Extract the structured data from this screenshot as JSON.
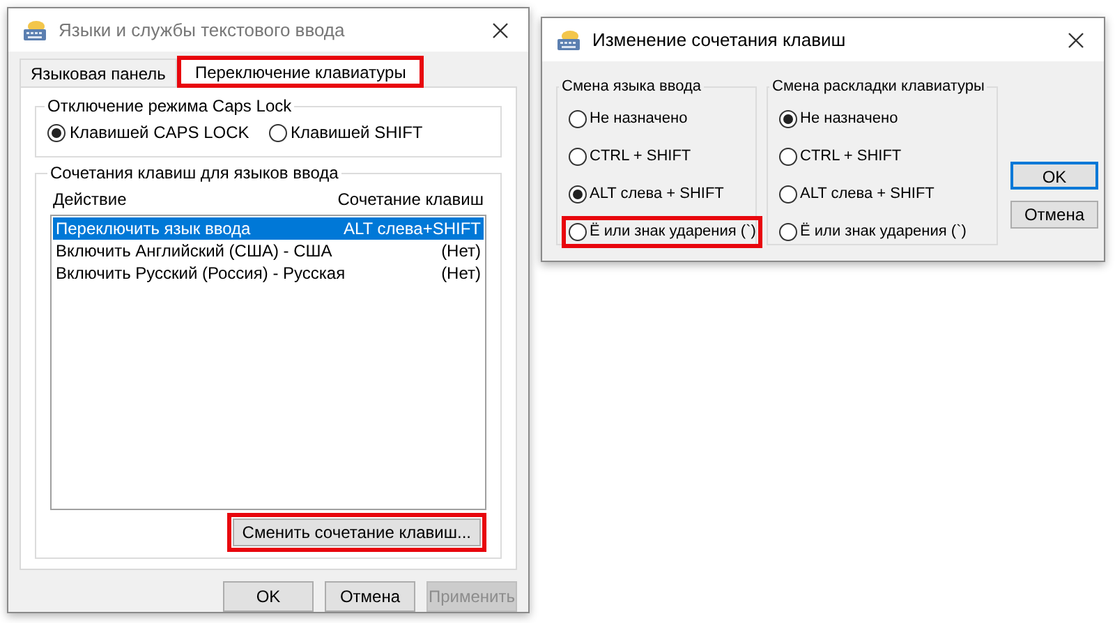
{
  "main_window": {
    "title": "Языки и службы текстового ввода",
    "tabs": [
      {
        "label": "Языковая панель",
        "selected": false,
        "highlighted": false
      },
      {
        "label": "Переключение клавиатуры",
        "selected": true,
        "highlighted": true
      }
    ],
    "caps_group": {
      "title": "Отключение режима Caps Lock",
      "options": [
        {
          "label": "Клавишей CAPS LOCK",
          "selected": true
        },
        {
          "label": "Клавишей SHIFT",
          "selected": false
        }
      ]
    },
    "hotkeys_group": {
      "title": "Сочетания клавиш для языков ввода",
      "columns": [
        "Действие",
        "Сочетание клавиш"
      ],
      "rows": [
        {
          "action": "Переключить язык ввода",
          "keys": "ALT слева+SHIFT",
          "selected": true
        },
        {
          "action": "Включить Английский (США) - США",
          "keys": "(Нет)",
          "selected": false
        },
        {
          "action": "Включить Русский (Россия) - Русская",
          "keys": "(Нет)",
          "selected": false
        }
      ],
      "change_button": {
        "label": "Сменить сочетание клавиш...",
        "highlighted": true
      }
    },
    "buttons": [
      {
        "label": "OK",
        "disabled": false
      },
      {
        "label": "Отмена",
        "disabled": false
      },
      {
        "label": "Применить",
        "disabled": true
      }
    ]
  },
  "change_dialog": {
    "title": "Изменение сочетания клавиш",
    "groups": [
      {
        "title": "Смена языка ввода",
        "options": [
          {
            "label": "Не назначено",
            "selected": false,
            "highlighted": false
          },
          {
            "label": "CTRL + SHIFT",
            "selected": false,
            "highlighted": false
          },
          {
            "label": "ALT слева + SHIFT",
            "selected": true,
            "highlighted": false
          },
          {
            "label": "Ё или знак ударения (`)",
            "selected": false,
            "highlighted": true
          }
        ]
      },
      {
        "title": "Смена раскладки клавиатуры",
        "options": [
          {
            "label": "Не назначено",
            "selected": true,
            "highlighted": false
          },
          {
            "label": "CTRL + SHIFT",
            "selected": false,
            "highlighted": false
          },
          {
            "label": "ALT слева + SHIFT",
            "selected": false,
            "highlighted": false
          },
          {
            "label": "Ё или знак ударения (`)",
            "selected": false,
            "highlighted": false
          }
        ]
      }
    ],
    "buttons": [
      {
        "label": "OK",
        "default": true
      },
      {
        "label": "Отмена",
        "default": false
      }
    ]
  }
}
